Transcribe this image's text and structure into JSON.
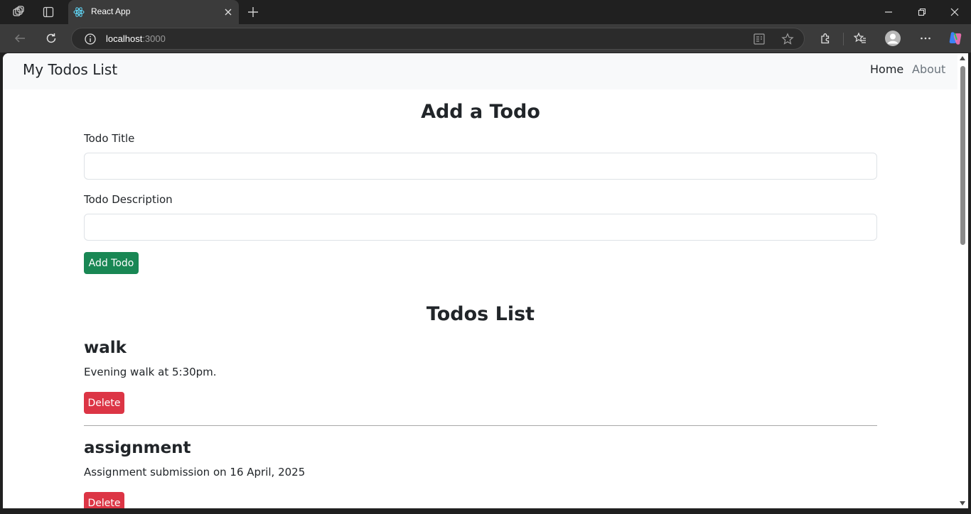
{
  "browser": {
    "tab_title": "React App",
    "address_host": "localhost",
    "address_port": ":3000"
  },
  "app": {
    "brand": "My Todos List",
    "nav": {
      "home": "Home",
      "about": "About"
    },
    "add_form": {
      "heading": "Add a Todo",
      "title_label": "Todo Title",
      "title_value": "",
      "desc_label": "Todo Description",
      "desc_value": "",
      "submit_label": "Add Todo"
    },
    "list": {
      "heading": "Todos List",
      "todos": [
        {
          "title": "walk",
          "desc": "Evening walk at 5:30pm.",
          "delete_label": "Delete"
        },
        {
          "title": "assignment",
          "desc": "Assignment submission on 16 April, 2025",
          "delete_label": "Delete"
        }
      ]
    }
  },
  "colors": {
    "success": "#198754",
    "danger": "#dc3545",
    "navbar_bg": "#f8f9fa",
    "chrome_bg": "#202020"
  }
}
